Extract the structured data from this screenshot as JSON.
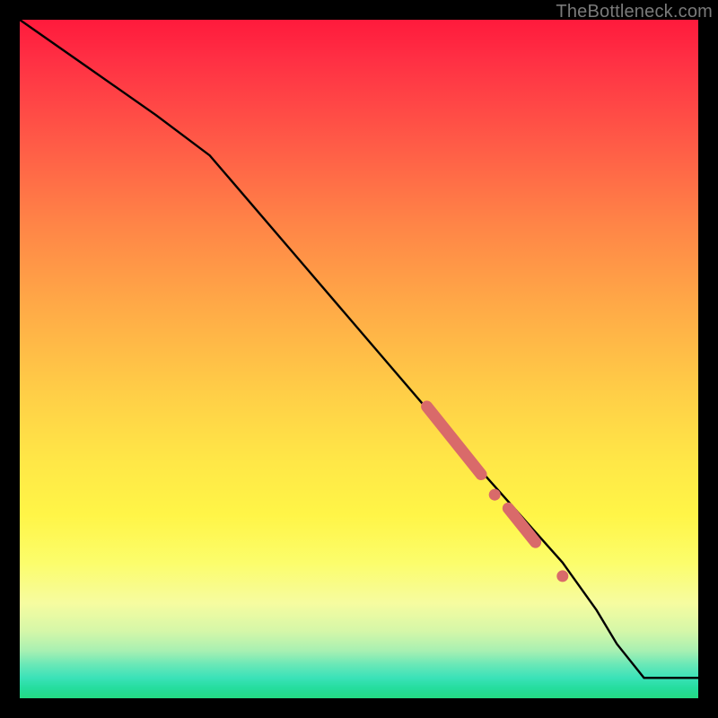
{
  "watermark": "TheBottleneck.com",
  "colors": {
    "line": "#000000",
    "marker": "#d96a6a",
    "marker_stroke": "#c95b5b"
  },
  "chart_data": {
    "type": "line",
    "title": "",
    "xlabel": "",
    "ylabel": "",
    "xlim": [
      0,
      100
    ],
    "ylim": [
      0,
      100
    ],
    "grid": false,
    "legend": false,
    "series": [
      {
        "name": "curve",
        "x": [
          0,
          10,
          20,
          28,
          40,
          52,
          64,
          72,
          80,
          85,
          88,
          92,
          100
        ],
        "y": [
          100,
          93,
          86,
          80,
          66,
          52,
          38,
          29,
          20,
          13,
          8,
          3,
          3
        ]
      }
    ],
    "markers": [
      {
        "name": "cluster-upper",
        "style": "thick-segment",
        "x_start": 60,
        "y_start": 43,
        "x_end": 68,
        "y_end": 33
      },
      {
        "name": "dot-mid",
        "style": "dot",
        "x": 70,
        "y": 30
      },
      {
        "name": "cluster-lower",
        "style": "thick-segment",
        "x_start": 72,
        "y_start": 28,
        "x_end": 76,
        "y_end": 23
      },
      {
        "name": "dot-low",
        "style": "dot",
        "x": 80,
        "y": 18
      }
    ]
  }
}
